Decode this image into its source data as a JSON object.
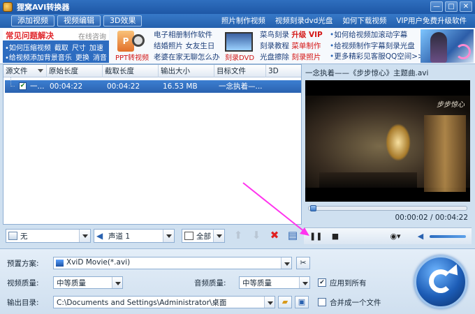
{
  "window": {
    "title": "狸窝AVI转换器",
    "buttons": [
      "—",
      "□",
      "✕"
    ]
  },
  "menu": {
    "buttons": [
      "添加视频",
      "视频编辑",
      "3D效果"
    ],
    "links": [
      "照片制作视频",
      "视频刻录dvd光盘",
      "如何下载视频",
      "VIP用户免费升级软件"
    ]
  },
  "banner": {
    "faq": {
      "title": "常见问题解决",
      "online": "在线咨询",
      "line1": [
        "•如何压缩视频",
        "截取",
        "尺寸",
        "加速"
      ],
      "line2": [
        "•给视频添加背景音乐",
        "更换",
        "消音"
      ]
    },
    "ppt_label": "PPT转视频",
    "col1": [
      "电子相册制作软件",
      "结婚照片 女友生日",
      "老婆在家无聊怎么办"
    ],
    "dvd_label": "刻录DVD",
    "col2": [
      {
        "text": "菜鸟刻录",
        "hot": "升级 VIP"
      },
      {
        "text": "刻录教程",
        "hot": "菜单制作"
      },
      {
        "text": "光盘擦除",
        "hot": "刻录照片"
      }
    ],
    "bullets": [
      "如何给视频加滚动字幕",
      "给视频制作字幕刻录光盘",
      "更多精彩见客服QQ空间>>"
    ]
  },
  "list": {
    "columns": [
      "源文件",
      "原始长度",
      "截取长度",
      "输出大小",
      "目标文件",
      "3D"
    ],
    "rows": [
      {
        "source": "一...",
        "original": "00:04:22",
        "clip": "00:04:22",
        "size": "16.53 MB",
        "target": "一念执着—...",
        "checked": "✔"
      }
    ]
  },
  "list_toolbar": {
    "subtitle": "无",
    "audio": "声道 1",
    "range": "全部"
  },
  "preview": {
    "title": "一念执着——《步步惊心》主题曲.avi",
    "video_logo": "步步惊心",
    "time": "00:00:02 / 00:04:22",
    "progress_fraction": 0.008
  },
  "settings": {
    "preset_label": "预置方案:",
    "preset_value": "XviD Movie(*.avi)",
    "video_quality_label": "视频质量:",
    "video_quality_value": "中等质量",
    "audio_quality_label": "音频质量:",
    "audio_quality_value": "中等质量",
    "apply_all": "应用到所有",
    "apply_all_checked": "✔",
    "output_label": "输出目录:",
    "output_path": "C:\\Documents and Settings\\Administrator\\桌面",
    "merge_label": "合并成一个文件"
  },
  "colors": {
    "accent": "#2a62b0",
    "annotation_arrow": "#ff33ee",
    "delete_red": "#e02020"
  }
}
